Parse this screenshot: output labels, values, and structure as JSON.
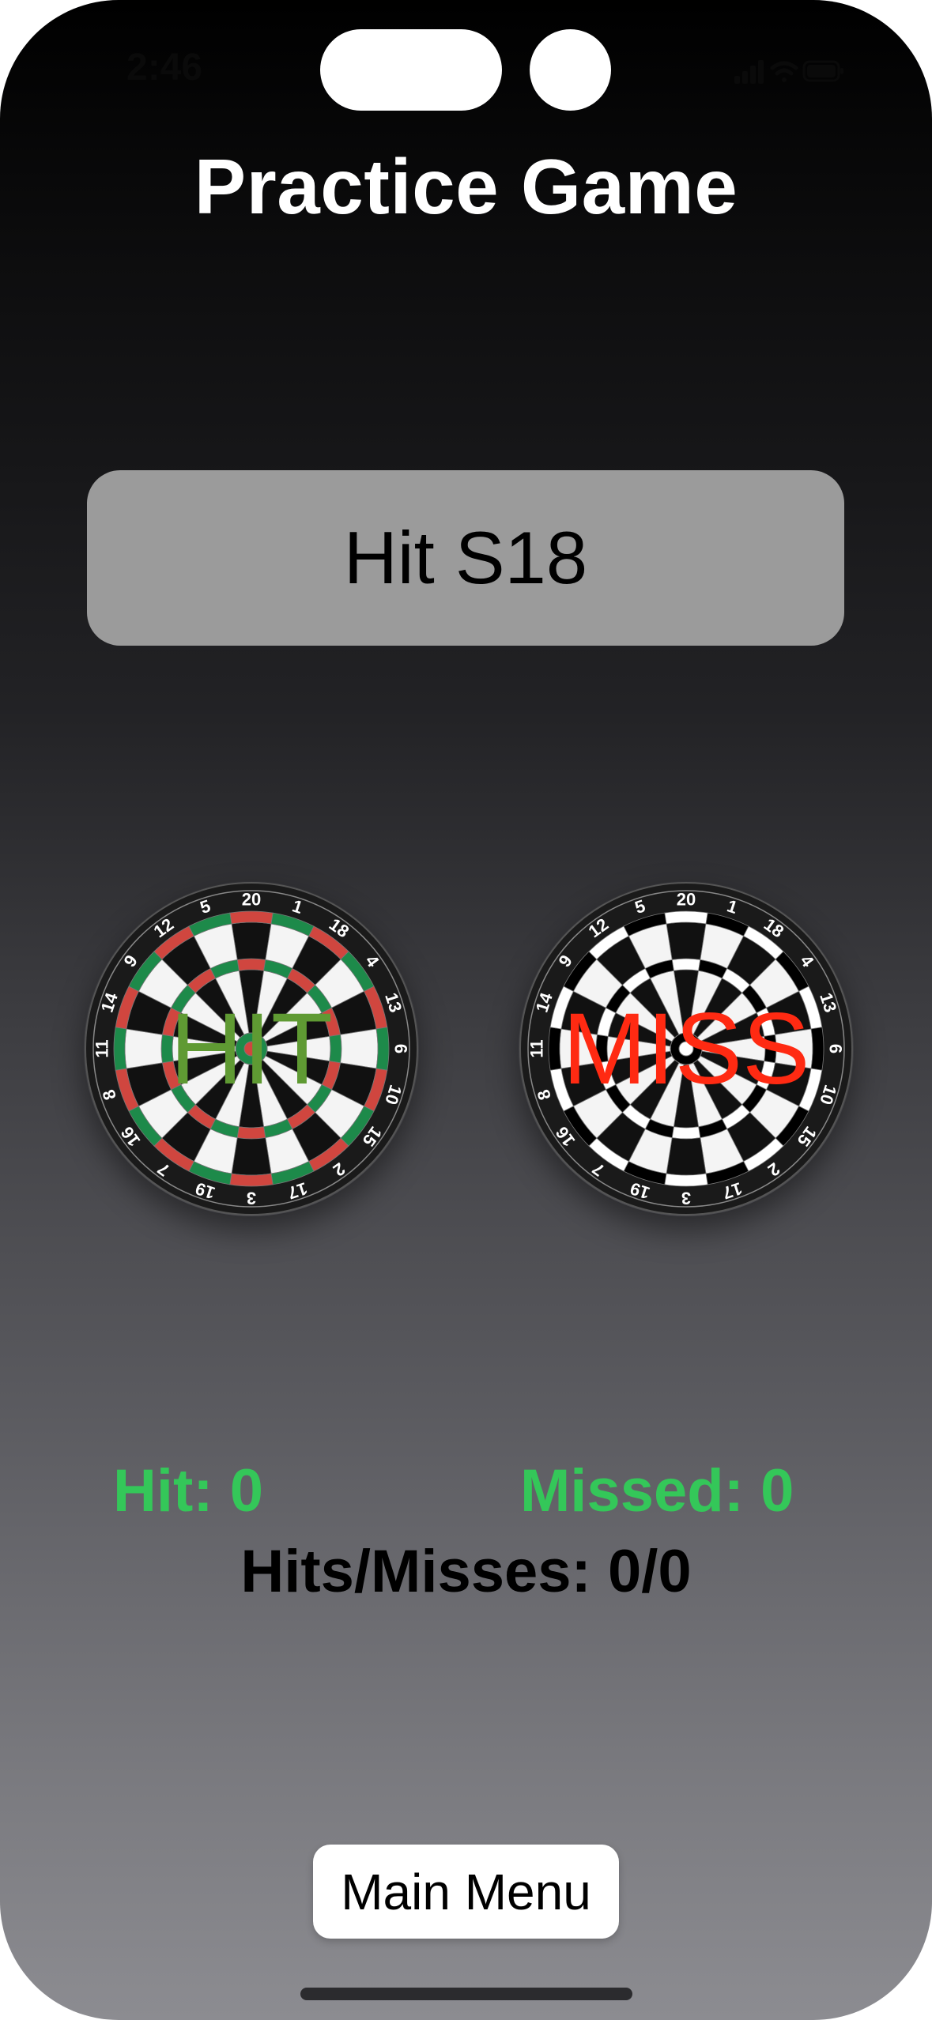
{
  "status_bar": {
    "time": "2:46",
    "icons": [
      "signal-icon",
      "wifi-icon",
      "battery-icon"
    ]
  },
  "title": "Practice Game",
  "target": {
    "label": "Hit S18"
  },
  "boards": {
    "hit": {
      "overlay": "HIT",
      "overlay_color": "#5f9a33",
      "ring_colors": [
        "#1d8a4a",
        "#d0463f"
      ]
    },
    "miss": {
      "overlay": "MISS",
      "overlay_color": "#ff2a12",
      "ring_colors": [
        "#000000",
        "#ffffff"
      ]
    },
    "numbers": [
      "20",
      "1",
      "18",
      "4",
      "13",
      "6",
      "10",
      "15",
      "2",
      "17",
      "3",
      "19",
      "7",
      "16",
      "8",
      "11",
      "14",
      "9",
      "12",
      "5"
    ]
  },
  "stats": {
    "hit": "Hit:  0",
    "missed": "Missed: 0",
    "ratio": "Hits/Misses: 0/0",
    "color": "#34c759"
  },
  "main_menu_button": "Main Menu"
}
